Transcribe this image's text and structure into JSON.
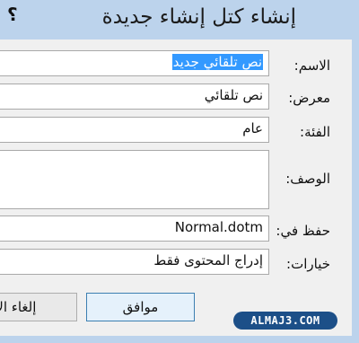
{
  "dialog": {
    "title": "إنشاء كتل إنشاء جديدة",
    "help_label": "؟"
  },
  "form": {
    "name_label": "الاسم:",
    "name_value": "نص تلقائي جديد",
    "gallery_label": "معرض:",
    "gallery_value": "نص تلقائي",
    "category_label": "الفئة:",
    "category_value": "عام",
    "description_label": "الوصف:",
    "description_value": "",
    "save_in_label": "حفظ في:",
    "save_in_value": "Normal.dotm",
    "options_label": "خيارات:",
    "options_value": "إدراج المحتوى فقط"
  },
  "buttons": {
    "ok_label": "موافق",
    "cancel_label": "إلغاء الأمر"
  },
  "watermark": {
    "text": "ALMAJ3.COM"
  }
}
